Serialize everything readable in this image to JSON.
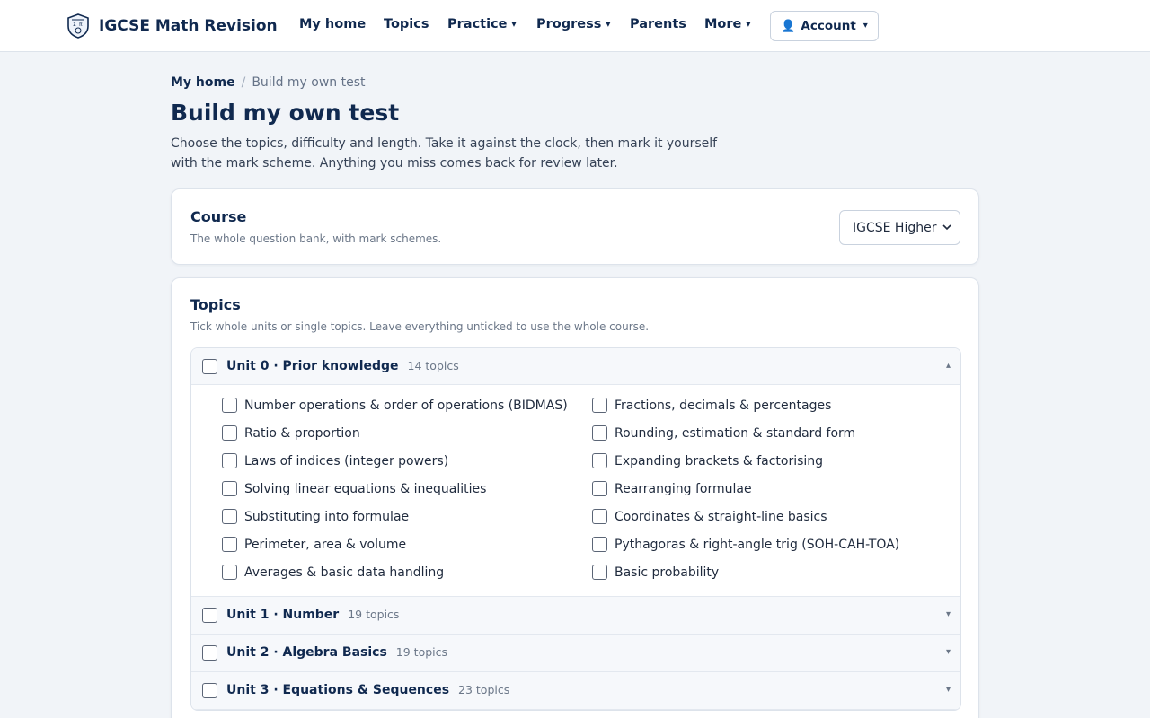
{
  "header": {
    "brand": "IGCSE Math Revision",
    "nav": [
      {
        "label": "My home",
        "dropdown": false
      },
      {
        "label": "Topics",
        "dropdown": false
      },
      {
        "label": "Practice",
        "dropdown": true
      },
      {
        "label": "Progress",
        "dropdown": true
      },
      {
        "label": "Parents",
        "dropdown": false
      },
      {
        "label": "More",
        "dropdown": true
      }
    ],
    "account_label": "Account",
    "caret": "▾",
    "account_icon": "person-icon"
  },
  "breadcrumb": {
    "home": "My home",
    "separator": "/",
    "current": "Build my own test"
  },
  "page": {
    "title": "Build my own test",
    "description": "Choose the topics, difficulty and length. Take it against the clock, then mark it yourself with the mark scheme. Anything you miss comes back for review later."
  },
  "course": {
    "title": "Course",
    "subtitle": "The whole question bank, with mark schemes.",
    "selected": "IGCSE Higher"
  },
  "topics": {
    "title": "Topics",
    "subtitle": "Tick whole units or single topics. Leave everything unticked to use the whole course.",
    "units": [
      {
        "title": "Unit 0 · Prior knowledge",
        "count": "14 topics",
        "expanded": true,
        "toggle": "▴",
        "items": [
          "Number operations & order of operations (BIDMAS)",
          "Fractions, decimals & percentages",
          "Ratio & proportion",
          "Rounding, estimation & standard form",
          "Laws of indices (integer powers)",
          "Expanding brackets & factorising",
          "Solving linear equations & inequalities",
          "Rearranging formulae",
          "Substituting into formulae",
          "Coordinates & straight-line basics",
          "Perimeter, area & volume",
          "Pythagoras & right-angle trig (SOH-CAH-TOA)",
          "Averages & basic data handling",
          "Basic probability"
        ]
      },
      {
        "title": "Unit 1 · Number",
        "count": "19 topics",
        "expanded": false,
        "toggle": "▾"
      },
      {
        "title": "Unit 2 · Algebra Basics",
        "count": "19 topics",
        "expanded": false,
        "toggle": "▾"
      },
      {
        "title": "Unit 3 · Equations & Sequences",
        "count": "23 topics",
        "expanded": false,
        "toggle": "▾"
      }
    ]
  },
  "colors": {
    "brand_navy": "#10294f",
    "page_bg": "#f1f4f8",
    "accent_blue": "#3b6fd8"
  }
}
